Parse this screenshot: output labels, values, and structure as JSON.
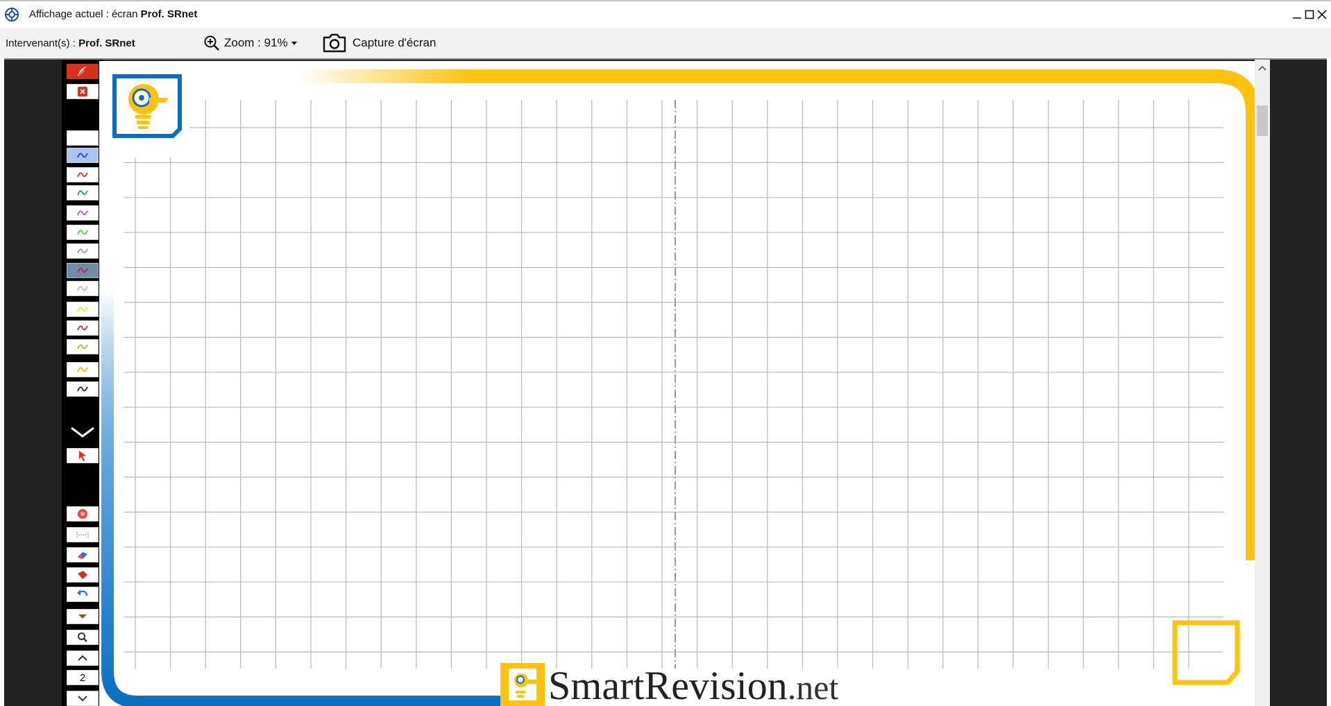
{
  "window": {
    "title_prefix": "Affichage actuel : écran",
    "title_owner": "Prof. SRnet"
  },
  "infobar": {
    "presenters_label": "Intervenant(s) :",
    "presenters_value": "Prof. SRnet",
    "zoom_label": "Zoom : 91%",
    "capture_label": "Capture d'écran"
  },
  "toolbar": {
    "pen_colors": [
      "#2c3fc9",
      "#c0392b",
      "#1f9d6a",
      "#c447d6",
      "#3fd14b",
      "#9a9a9a",
      "#c2187a",
      "#c9a6e8",
      "#e6e62a",
      "#b5302a",
      "#a4c21a",
      "#e6b800",
      "#222222"
    ],
    "page_number": "2"
  },
  "slide": {
    "brand_name": "SmartRevision",
    "brand_tld": ".net",
    "colors": {
      "yellow": "#ffc20e",
      "blue": "#0a6fc2",
      "grid": "#b8b8b8"
    }
  }
}
